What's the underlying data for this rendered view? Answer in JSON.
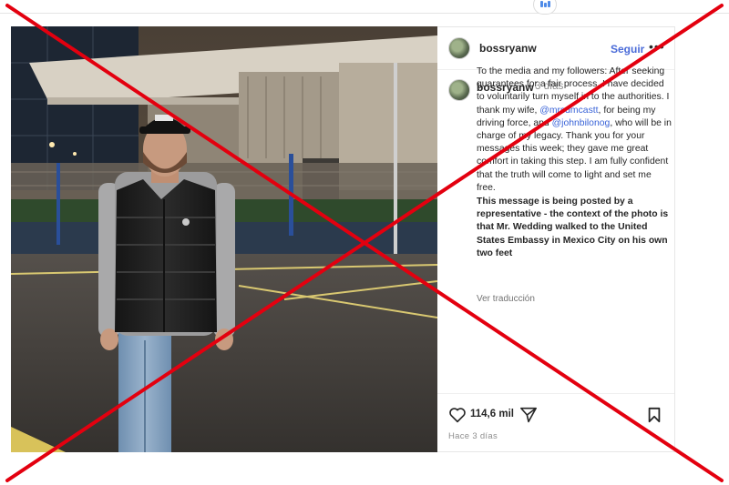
{
  "top_indicator": "",
  "post": {
    "username": "bossryanw",
    "follow_label": "Seguir",
    "more_label": "•••",
    "time_ago": "3 días",
    "caption": {
      "part1": "To the media and my followers: After seeking guarantees for a fair process, I have decided to voluntarily turn myself in to the authorities. I thank my wife, ",
      "mention1": "@mrsdmcastt",
      "part2": ", for being my driving force, and ",
      "mention2": "@johnbilonog",
      "part3": ", who will be in charge of my legacy. Thank you for your messages this week; they gave me great comfort in taking this step. I am fully confident that the truth will come to light and set me free.",
      "bold_note": "This message is being posted by a representative - the context of the photo is that Mr. Wedding walked to the United States Embassy in Mexico City on his own two feet"
    },
    "translate_label": "Ver traducción",
    "likes": "114,6 mil",
    "date": "Hace 3 días"
  },
  "overlay": {
    "cross_color": "#e3000f"
  }
}
